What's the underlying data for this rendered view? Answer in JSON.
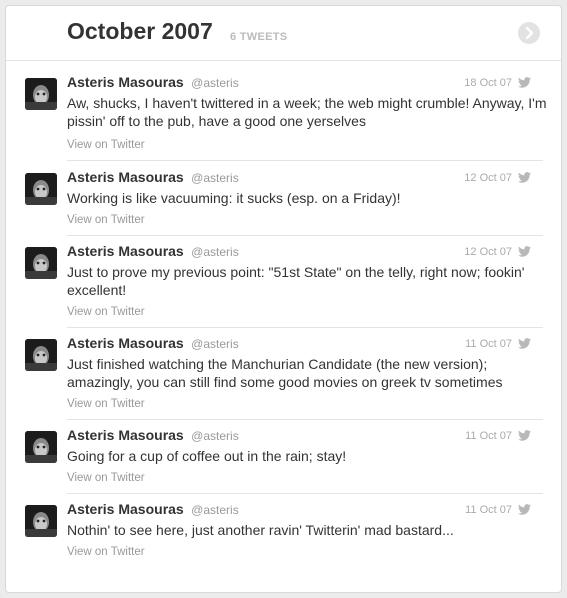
{
  "header": {
    "title": "October 2007",
    "count_label": "6 TWEETS"
  },
  "colors": {
    "text": "#333333",
    "muted": "#999999",
    "divider": "#e4e4e4"
  },
  "icons": {
    "next": "chevron-right-icon",
    "source": "twitter-bird-icon"
  },
  "tweets": [
    {
      "author": "Asteris Masouras",
      "handle": "@asteris",
      "date": "18 Oct 07",
      "text": "Aw, shucks, I haven't twittered in a week; the web might crumble! Anyway, I'm pissin' off to the pub, have a good one yerselves",
      "link": "View on Twitter"
    },
    {
      "author": "Asteris Masouras",
      "handle": "@asteris",
      "date": "12 Oct 07",
      "text": "Working is like vacuuming: it sucks (esp. on a Friday)!",
      "link": "View on Twitter"
    },
    {
      "author": "Asteris Masouras",
      "handle": "@asteris",
      "date": "12 Oct 07",
      "text": "Just to prove my previous point: \"51st State\" on the telly, right now; fookin' excellent!",
      "link": "View on Twitter"
    },
    {
      "author": "Asteris Masouras",
      "handle": "@asteris",
      "date": "11 Oct 07",
      "text": "Just finished watching the Manchurian Candidate (the new version); amazingly, you can still find some good movies on greek tv sometimes",
      "link": "View on Twitter"
    },
    {
      "author": "Asteris Masouras",
      "handle": "@asteris",
      "date": "11 Oct 07",
      "text": "Going for a cup of coffee out in the rain; stay!",
      "link": "View on Twitter"
    },
    {
      "author": "Asteris Masouras",
      "handle": "@asteris",
      "date": "11 Oct 07",
      "text": "Nothin' to see here, just another ravin' Twitterin' mad bastard...",
      "link": "View on Twitter"
    }
  ]
}
